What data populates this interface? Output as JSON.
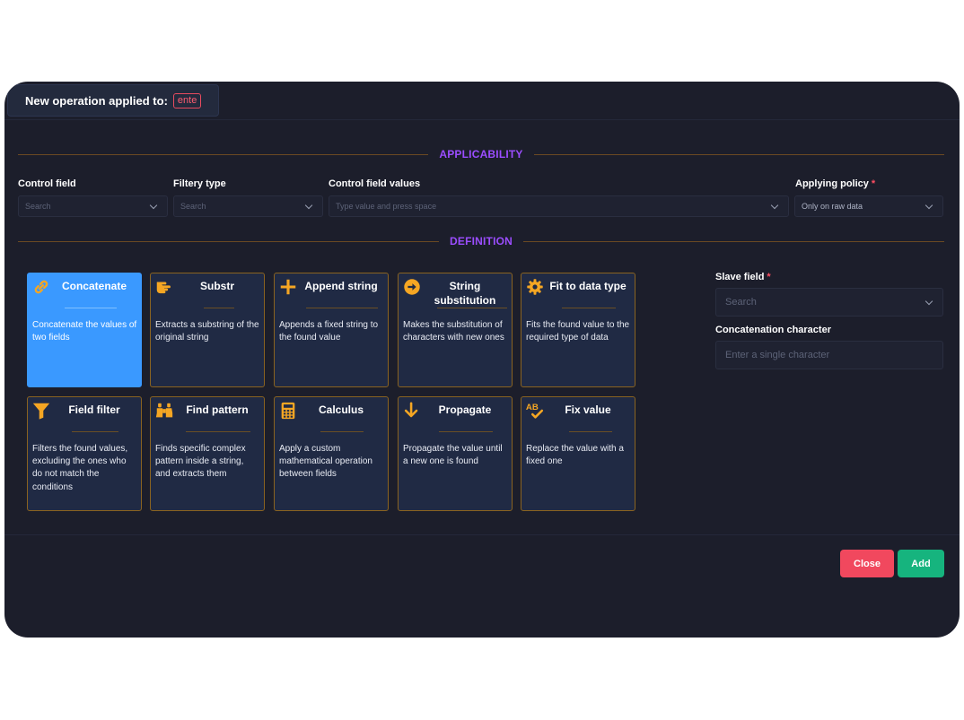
{
  "header": {
    "title": "New operation applied to:",
    "target": "ente"
  },
  "sections": {
    "applicability": "APPLICABILITY",
    "definition": "DEFINITION"
  },
  "filters": {
    "control_field": {
      "label": "Control field",
      "placeholder": "Search"
    },
    "filtery_type": {
      "label": "Filtery type",
      "placeholder": "Search"
    },
    "control_values": {
      "label": "Control field values",
      "placeholder": "Type value and press space"
    },
    "applying_policy": {
      "label": "Applying policy",
      "required": "*",
      "value": "Only on raw data"
    }
  },
  "operations": [
    {
      "title": "Concatenate",
      "desc": "Concatenate the values of two fields",
      "icon": "link-icon",
      "active": true
    },
    {
      "title": "Substr",
      "desc": "Extracts a substring of the original string",
      "icon": "hand-scissors-icon"
    },
    {
      "title": "Append string",
      "desc": "Appends a fixed string to the found value",
      "icon": "plus-icon"
    },
    {
      "title": "String substitution",
      "desc": "Makes the substitution of characters with new ones",
      "icon": "arrow-circle-right-icon"
    },
    {
      "title": "Fit to data type",
      "desc": "Fits the found value to the required type of data",
      "icon": "cog-icon"
    },
    {
      "title": "Field filter",
      "desc": "Filters the found values, excluding the ones who do not match the conditions",
      "icon": "filter-icon"
    },
    {
      "title": "Find pattern",
      "desc": "Finds specific complex pattern inside a string, and extracts them",
      "icon": "binoculars-icon"
    },
    {
      "title": "Calculus",
      "desc": "Apply a custom mathematical operation between fields",
      "icon": "calculator-icon"
    },
    {
      "title": "Propagate",
      "desc": "Propagate the value until a new one is found",
      "icon": "arrow-down-icon"
    },
    {
      "title": "Fix value",
      "desc": "Replace the value with a fixed one",
      "icon": "spell-check-icon",
      "icon_text": "AB"
    }
  ],
  "right_panel": {
    "slave_field": {
      "label": "Slave field",
      "required": "*",
      "placeholder": "Search"
    },
    "concat_char": {
      "label": "Concatenation character",
      "placeholder": "Enter a single character"
    }
  },
  "buttons": {
    "close": "Close",
    "add": "Add"
  },
  "colors": {
    "accent_orange": "#f5a623",
    "accent_purple": "#9b4dff",
    "active_card": "#3a99ff",
    "danger": "#f1485e",
    "success": "#16b47e"
  }
}
